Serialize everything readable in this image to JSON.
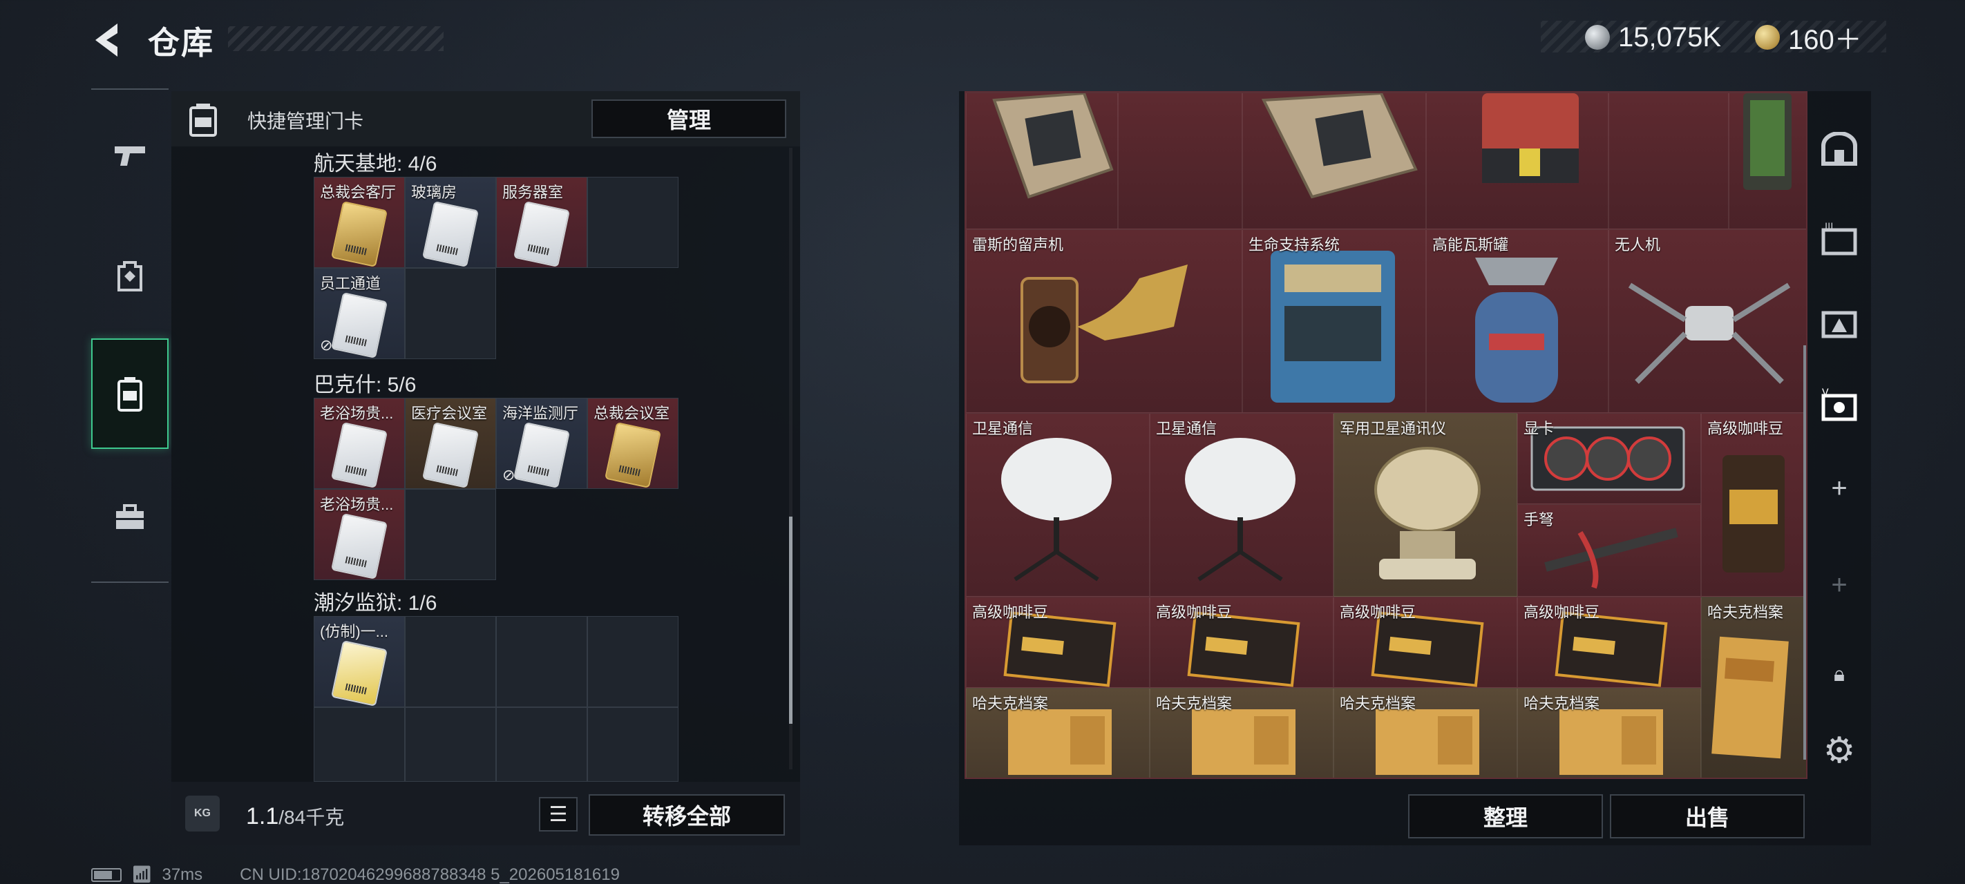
{
  "header": {
    "title": "仓库",
    "currency_silver": "15,075K",
    "currency_gold": "160＋"
  },
  "left_nav": {
    "items": [
      {
        "name": "weapons",
        "icon": "pistol-icon"
      },
      {
        "name": "equipment",
        "icon": "backpack-icon"
      },
      {
        "name": "keycards",
        "icon": "keycard-case-icon",
        "active": true
      },
      {
        "name": "other",
        "icon": "toolbox-icon"
      }
    ]
  },
  "keycard_panel": {
    "header_label": "快捷管理门卡",
    "manage_label": "管理",
    "groups": [
      {
        "title": "航天基地: 4/6",
        "cards": [
          "总裁会客厅",
          "玻璃房",
          "服务器室",
          "员工通道"
        ]
      },
      {
        "title": "巴克什: 5/6",
        "cards": [
          "老浴场贵...",
          "医疗会议室",
          "海洋监测厅",
          "总裁会议室",
          "老浴场贵..."
        ]
      },
      {
        "title": "潮汐监狱: 1/6",
        "cards": [
          "(仿制)一..."
        ]
      }
    ],
    "weight_value": "1.1",
    "weight_capacity": "/84千克",
    "kg_label": "KG",
    "transfer_label": "转移全部"
  },
  "stash": {
    "items": [
      "雷斯的留声机",
      "生命支持系统",
      "高能瓦斯罐",
      "无人机",
      "卫星通信",
      "卫星通信",
      "军用卫星通讯仪",
      "显卡",
      "高级咖啡豆",
      "手弩",
      "高级咖啡豆",
      "高级咖啡豆",
      "高级咖啡豆",
      "高级咖啡豆",
      "哈夫克档案",
      "哈夫克档案",
      "哈夫克档案",
      "哈夫克档案",
      "哈夫克档案"
    ],
    "sort_label": "整理",
    "sell_label": "出售"
  },
  "status": {
    "ping": "37ms",
    "uid": "CN UID:18702046299688788348 5_202605181619"
  },
  "colors": {
    "accent_green": "#3ec98e",
    "stash_red": "#4a2228"
  }
}
